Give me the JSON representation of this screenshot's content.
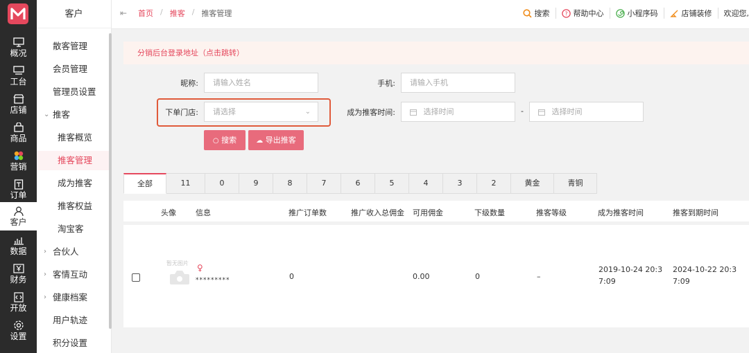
{
  "rail": {
    "items": [
      {
        "label": "概况",
        "icon": "monitor-icon"
      },
      {
        "label": "工台",
        "icon": "desktop-icon"
      },
      {
        "label": "店铺",
        "icon": "shop-icon"
      },
      {
        "label": "商品",
        "icon": "bag-icon"
      },
      {
        "label": "营销",
        "icon": "flower-icon"
      },
      {
        "label": "订单",
        "icon": "order-icon"
      },
      {
        "label": "客户",
        "icon": "user-icon"
      },
      {
        "label": "数据",
        "icon": "chart-icon"
      },
      {
        "label": "财务",
        "icon": "yen-icon"
      },
      {
        "label": "开放",
        "icon": "code-icon"
      },
      {
        "label": "设置",
        "icon": "gear-icon"
      }
    ]
  },
  "sidebar": {
    "title": "客户",
    "items": {
      "sanke": "散客管理",
      "huiyuan": "会员管理",
      "guanliyuan": "管理员设置",
      "tuike": "推客",
      "tuike_overview": "推客概览",
      "tuike_manage": "推客管理",
      "become_tuike": "成为推客",
      "tuike_rights": "推客权益",
      "taobaoke": "淘宝客",
      "partner": "合伙人",
      "interaction": "客情互动",
      "health": "健康档案",
      "track": "用户轨迹",
      "points": "积分设置"
    }
  },
  "header": {
    "breadcrumb": {
      "home": "首页",
      "parent": "推客",
      "current": "推客管理",
      "sep": "/"
    },
    "search": "搜索",
    "help": "帮助中心",
    "miniapp": "小程序码",
    "decorate": "店铺装修",
    "welcome": "欢迎您,"
  },
  "notice": "分销后台登录地址（点击跳转）",
  "form": {
    "nickname_label": "昵称:",
    "nickname_placeholder": "请输入姓名",
    "phone_label": "手机:",
    "phone_placeholder": "请输入手机",
    "store_label": "下单门店:",
    "store_placeholder": "请选择",
    "time_label": "成为推客时间:",
    "time_start": "选择时间",
    "time_sep": "-",
    "time_end": "选择时间",
    "search_btn": "搜索",
    "export_btn": "导出推客"
  },
  "tabs": [
    "全部",
    "11",
    "0",
    "9",
    "8",
    "7",
    "6",
    "5",
    "4",
    "3",
    "2",
    "黄金",
    "青铜"
  ],
  "table": {
    "columns": [
      "头像",
      "信息",
      "推广订单数",
      "推广收入总佣金",
      "可用佣金",
      "下级数量",
      "推客等级",
      "成为推客时间",
      "推客到期时间"
    ],
    "row": {
      "avatar_text": "暂无图片",
      "gender": "♀",
      "name": "*********",
      "orders": "0",
      "commission_total": "",
      "available": "0.00",
      "subordinates": "0",
      "level": "–",
      "join_time_line1": "2019-10-24 20:3",
      "join_time_line2": "7:09",
      "expire_line1": "2024-10-22 20:3",
      "expire_line2": "7:09"
    }
  },
  "colors": {
    "accent": "#e5485d",
    "button": "#e86b7c",
    "rail": "#2b2b2b",
    "highlight": "#e05a3a"
  }
}
